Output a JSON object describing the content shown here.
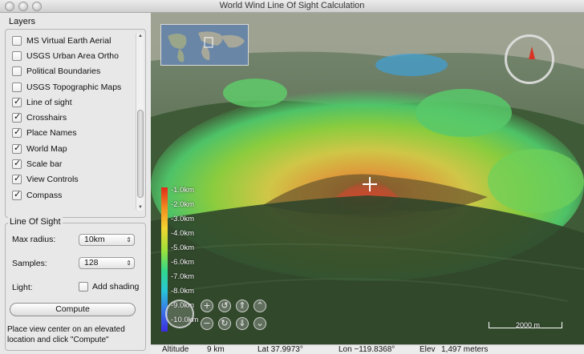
{
  "window": {
    "title": "World Wind Line Of Sight Calculation"
  },
  "layers": {
    "group_label": "Layers",
    "items": [
      {
        "label": "MS Virtual Earth Aerial",
        "checked": false
      },
      {
        "label": "USGS Urban Area Ortho",
        "checked": false
      },
      {
        "label": "Political Boundaries",
        "checked": false
      },
      {
        "label": "USGS Topographic Maps",
        "checked": false
      },
      {
        "label": "Line of sight",
        "checked": true
      },
      {
        "label": "Crosshairs",
        "checked": true
      },
      {
        "label": "Place Names",
        "checked": true
      },
      {
        "label": "World Map",
        "checked": true
      },
      {
        "label": "Scale bar",
        "checked": true
      },
      {
        "label": "View Controls",
        "checked": true
      },
      {
        "label": "Compass",
        "checked": true
      }
    ]
  },
  "line_of_sight": {
    "group_label": "Line Of Sight",
    "max_radius_label": "Max radius:",
    "max_radius_value": "10km",
    "samples_label": "Samples:",
    "samples_value": "128",
    "light_label": "Light:",
    "add_shading_label": "Add shading",
    "add_shading_checked": false,
    "compute_label": "Compute",
    "hint_line1": "Place view center on an elevated",
    "hint_line2": "location and click \"Compute\""
  },
  "legend": {
    "labels": [
      "-1.0km",
      "-2.0km",
      "-3.0km",
      "-4.0km",
      "-5.0km",
      "-6.0km",
      "-7.0km",
      "-8.0km",
      "-9.0km",
      "-10.0km"
    ]
  },
  "scale": {
    "label": "2000 m"
  },
  "status": {
    "altitude_label": "Altitude",
    "altitude_value": "9 km",
    "lat_text": "Lat 37.9973°",
    "lon_text": "Lon −119.8368°",
    "elev_label": "Elev",
    "elev_value": "1,497 meters"
  },
  "colors": {
    "compass_needle": "#d93325",
    "legend_top": "#e02a1a",
    "legend_bottom": "#3b2de0"
  },
  "icons": {
    "compass": "compass-icon",
    "zoom_in": "zoom-in-icon",
    "zoom_out": "zoom-out-icon",
    "pan": "pan-icon"
  }
}
